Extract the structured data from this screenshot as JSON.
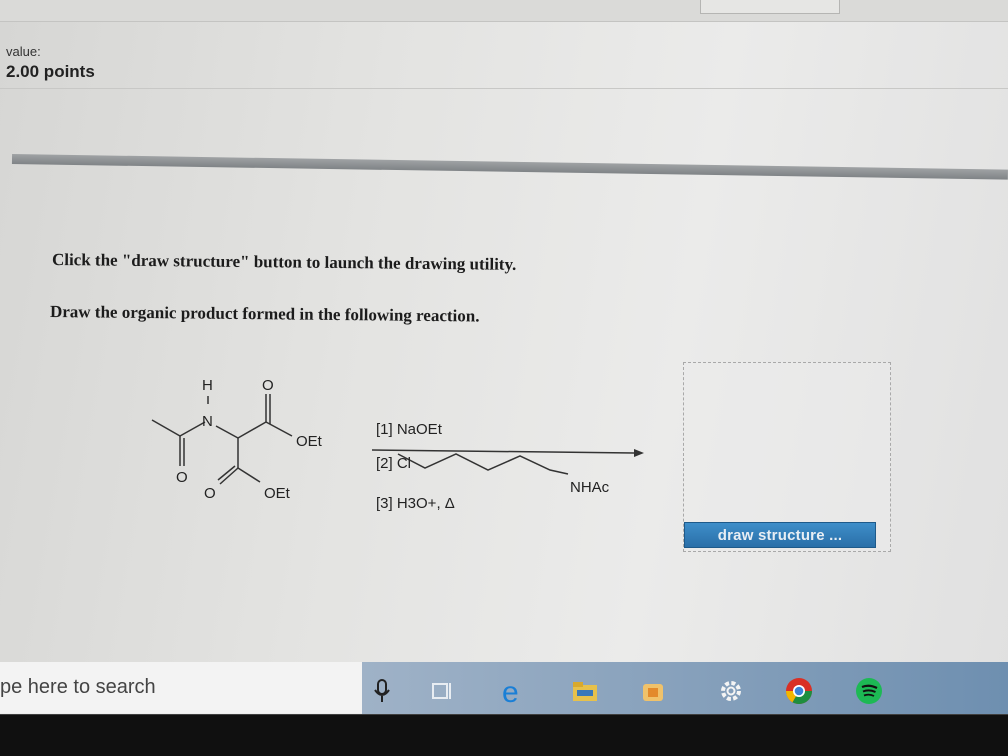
{
  "header": {
    "value_label": "value:",
    "points": "2.00 points"
  },
  "question": {
    "instruction": "Click the \"draw structure\" button to launch the drawing utility.",
    "prompt": "Draw the organic product formed in the following reaction."
  },
  "reaction": {
    "reactant_atoms": {
      "h": "H",
      "n": "N",
      "o_ketone": "O",
      "o_amide": "O",
      "o_ester_top": "O",
      "oet_top": "OEt",
      "o_ester_bottom": "O",
      "oet_bottom": "OEt"
    },
    "reagent_1": "[1] NaOEt",
    "reagent_2": "[2] Cl",
    "reagent_2_group": "NHAc",
    "reagent_3": "[3] H3O+, Δ"
  },
  "answer": {
    "button_label": "draw structure ..."
  },
  "taskbar": {
    "search_placeholder": "pe here to search",
    "icons": [
      "microphone-icon",
      "task-view-icon",
      "edge-icon",
      "file-explorer-icon",
      "store-icon",
      "settings-icon",
      "chrome-icon",
      "spotify-icon"
    ]
  },
  "colors": {
    "button": "#2f7bb8",
    "taskbar": "#7e9cba"
  }
}
